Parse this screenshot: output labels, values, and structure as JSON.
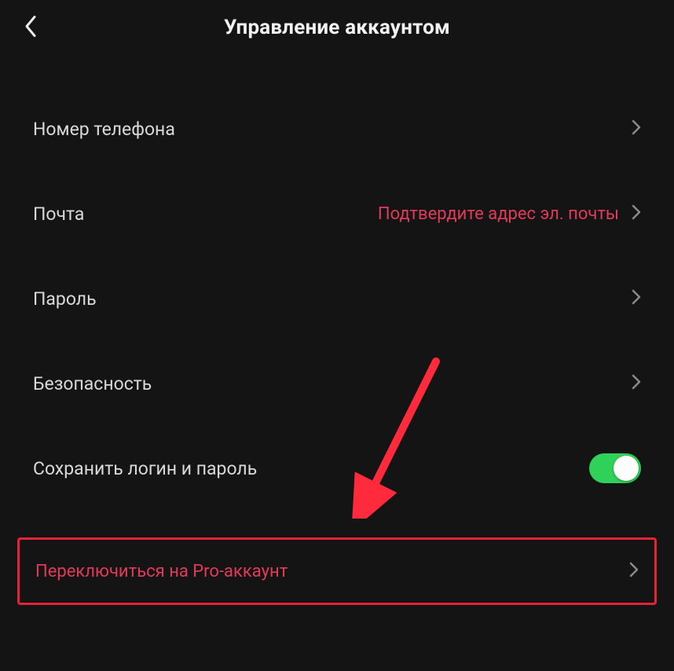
{
  "header": {
    "title": "Управление аккаунтом"
  },
  "rows": {
    "phone": {
      "label": "Номер телефона"
    },
    "email": {
      "label": "Почта",
      "value": "Подтвердите адрес эл. почты"
    },
    "password": {
      "label": "Пароль"
    },
    "security": {
      "label": "Безопасность"
    },
    "saveLogin": {
      "label": "Сохранить логин и пароль",
      "toggle": true
    },
    "proAccount": {
      "label": "Переключиться на Pro-аккаунт"
    }
  },
  "colors": {
    "accent": "#e23a5a",
    "highlight": "#e6223a",
    "toggleOn": "#30d158"
  }
}
